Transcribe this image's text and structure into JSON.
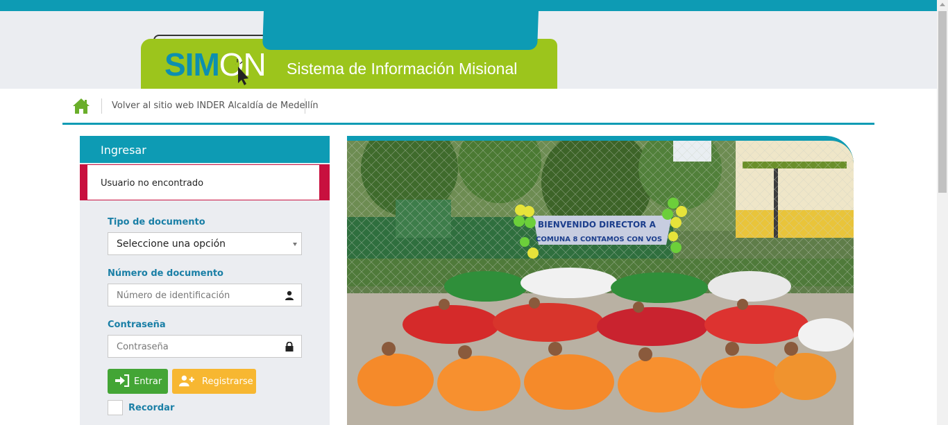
{
  "header": {
    "logo_text_a": "SIM",
    "logo_text_b": "ON",
    "tagline": "Sistema de Información Misional"
  },
  "nav": {
    "home_icon": "home-icon",
    "link_label": "Volver al sitio web INDER Alcaldía de Medellín"
  },
  "login": {
    "title": "Ingresar",
    "alert": "Usuario no encontrado",
    "doc_type_label": "Tipo de documento",
    "doc_type_selected": "Seleccione una opción",
    "doc_number_label": "Número de documento",
    "doc_number_placeholder": "Número de identificación",
    "password_label": "Contraseña",
    "password_placeholder": "Contraseña",
    "enter_button": "Entrar",
    "register_button": "Registrarse",
    "remember_label": "Recordar"
  },
  "photo": {
    "banner_line1": "BIENVENIDO DIRECTOR A",
    "banner_line2": "COMUNA 8 CONTAMOS CON VOS"
  },
  "colors": {
    "teal": "#0d9bb4",
    "green": "#9cc51c",
    "alert_red": "#c8103e",
    "enter_green": "#43a535",
    "register_yellow": "#f7b731"
  }
}
